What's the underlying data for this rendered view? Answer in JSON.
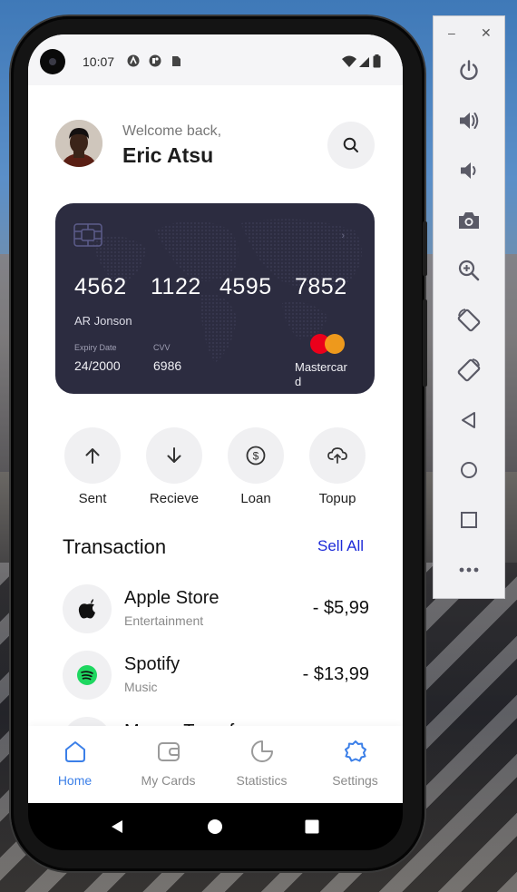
{
  "status_bar": {
    "time": "10:07"
  },
  "header": {
    "welcome": "Welcome back,",
    "user_name": "Eric Atsu"
  },
  "card": {
    "number_groups": [
      "4562",
      "1122",
      "4595",
      "7852"
    ],
    "holder": "AR Jonson",
    "expiry_label": "Expiry Date",
    "expiry_value": "24/2000",
    "cvv_label": "CVV",
    "cvv_value": "6986",
    "brand": "Mastercard"
  },
  "actions": [
    {
      "label": "Sent",
      "icon": "arrow-up-icon"
    },
    {
      "label": "Recieve",
      "icon": "arrow-down-icon"
    },
    {
      "label": "Loan",
      "icon": "dollar-coin-icon"
    },
    {
      "label": "Topup",
      "icon": "cloud-upload-icon"
    }
  ],
  "transactions": {
    "title": "Transaction",
    "see_all": "Sell All",
    "items": [
      {
        "name": "Apple Store",
        "category": "Entertainment",
        "amount": "- $5,99",
        "icon": "apple-icon"
      },
      {
        "name": "Spotify",
        "category": "Music",
        "amount": "- $13,99",
        "icon": "spotify-icon"
      },
      {
        "name": "Money Transfer",
        "category": "",
        "amount": "",
        "icon": "transfer-icon"
      }
    ]
  },
  "nav": {
    "items": [
      {
        "label": "Home",
        "icon": "home-icon",
        "active": true
      },
      {
        "label": "My Cards",
        "icon": "wallet-icon",
        "active": false
      },
      {
        "label": "Statistics",
        "icon": "pie-chart-icon",
        "active": false
      },
      {
        "label": "Settings",
        "icon": "settings-icon",
        "active": false
      }
    ]
  },
  "colors": {
    "accent": "#3b7fe8",
    "link": "#1d2bd8",
    "card": "#2c2c40",
    "mc_red": "#eb001b",
    "mc_yellow": "#f79e1b"
  },
  "emulator_toolbar": {
    "items": [
      "minimize-icon",
      "close-icon",
      "power-icon",
      "volume-up-icon",
      "volume-down-icon",
      "camera-icon",
      "zoom-icon",
      "rotate-left-icon",
      "rotate-right-icon",
      "back-icon",
      "home-circle-icon",
      "overview-icon",
      "more-icon"
    ]
  }
}
